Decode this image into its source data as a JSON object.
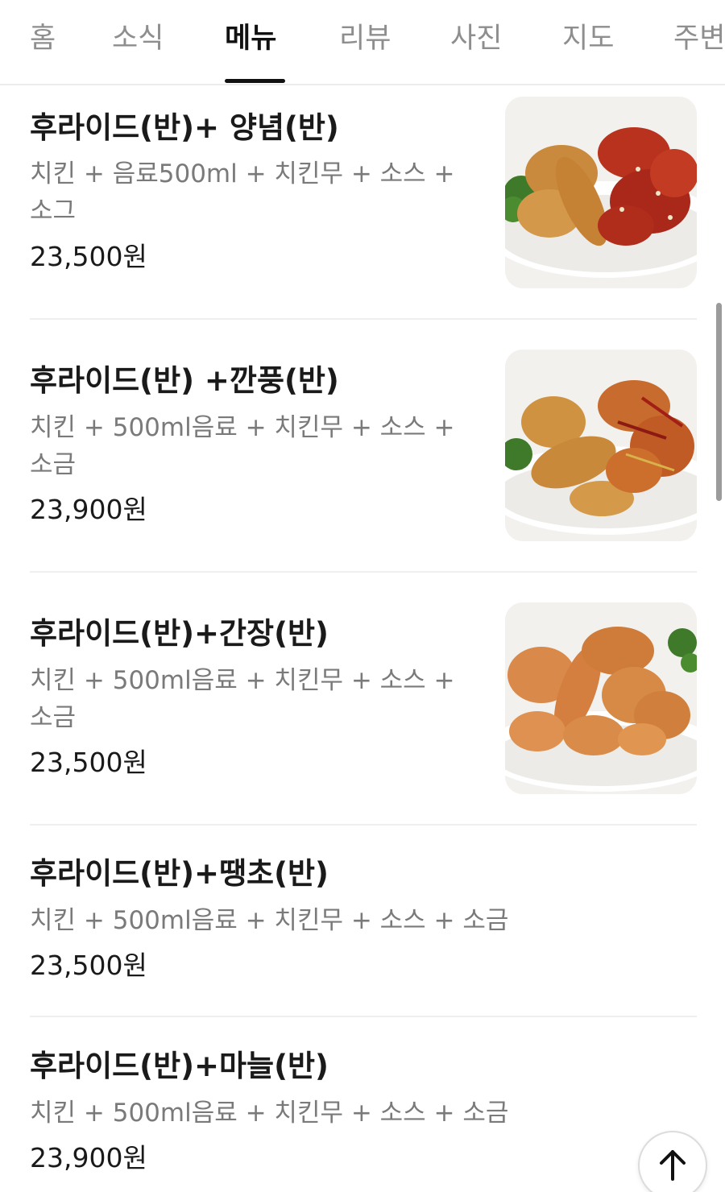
{
  "tabs": [
    {
      "label": "홈",
      "active": false
    },
    {
      "label": "소식",
      "active": false
    },
    {
      "label": "메뉴",
      "active": true
    },
    {
      "label": "리뷰",
      "active": false
    },
    {
      "label": "사진",
      "active": false
    },
    {
      "label": "지도",
      "active": false
    },
    {
      "label": "주변",
      "active": false
    }
  ],
  "menu": [
    {
      "title": "후라이드(반)+ 양념(반)",
      "desc": "치킨 + 음료500ml + 치킨무 + 소스 + 소그",
      "price": "23,500원",
      "has_image": true
    },
    {
      "title": "후라이드(반) +깐풍(반)",
      "desc": "치킨 + 500ml음료 + 치킨무 + 소스 + 소금",
      "price": "23,900원",
      "has_image": true
    },
    {
      "title": "후라이드(반)+간장(반)",
      "desc": "치킨 + 500ml음료 + 치킨무 + 소스 + 소금",
      "price": "23,500원",
      "has_image": true
    },
    {
      "title": "후라이드(반)+땡초(반)",
      "desc": "치킨 + 500ml음료 + 치킨무 + 소스 + 소금",
      "price": "23,500원",
      "has_image": false
    },
    {
      "title": "후라이드(반)+마늘(반)",
      "desc": "치킨 + 500ml음료 + 치킨무 + 소스 + 소금",
      "price": "23,900원",
      "has_image": false
    }
  ],
  "icons": {
    "scroll_top": "arrow-up-icon"
  },
  "colors": {
    "active_tab": "#111111",
    "inactive_tab": "#8e8e8e",
    "description": "#7a7a7a",
    "divider": "#efefef"
  }
}
